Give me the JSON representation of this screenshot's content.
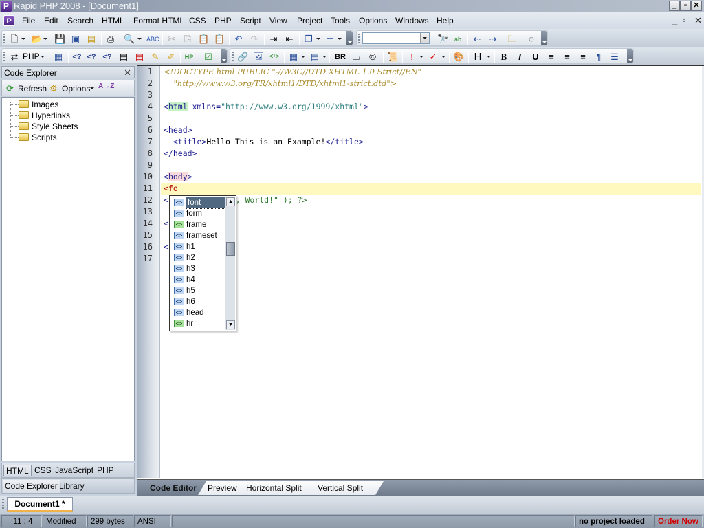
{
  "window": {
    "title": "Rapid PHP 2008 - [Document1]",
    "app_icon_letter": "P",
    "controls": {
      "minimize": "_",
      "restore": "▫",
      "close": "✕"
    }
  },
  "menubar": {
    "items": [
      {
        "label": "File",
        "mnemonic": "F"
      },
      {
        "label": "Edit",
        "mnemonic": "E"
      },
      {
        "label": "Search",
        "mnemonic": "S"
      },
      {
        "label": "HTML",
        "mnemonic": "L"
      },
      {
        "label": "Format HTML",
        "mnemonic": "m"
      },
      {
        "label": "CSS",
        "mnemonic": "C"
      },
      {
        "label": "PHP",
        "mnemonic": ""
      },
      {
        "label": "Script",
        "mnemonic": "i"
      },
      {
        "label": "View",
        "mnemonic": "V"
      },
      {
        "label": "Project",
        "mnemonic": "P"
      },
      {
        "label": "Tools",
        "mnemonic": "T"
      },
      {
        "label": "Options",
        "mnemonic": "O"
      },
      {
        "label": "Windows",
        "mnemonic": "W"
      },
      {
        "label": "Help",
        "mnemonic": "H"
      }
    ],
    "mdi_controls": {
      "minimize": "_",
      "restore": "▫",
      "close": "✕"
    }
  },
  "toolbar1": {
    "icons": [
      "new-document",
      "open-folder",
      "save",
      "save-all",
      "save-copy",
      "print",
      "preview",
      "spellcheck",
      "cut",
      "copy",
      "paste",
      "paste-special",
      "undo",
      "redo",
      "indent",
      "outdent",
      "window-layout",
      "panel-layout"
    ],
    "search_combo_value": "",
    "search_icons": [
      "find",
      "replace",
      "find-previous",
      "find-next",
      "find-in-files",
      "regex-search"
    ]
  },
  "toolbar2": {
    "php_button_label": "PHP",
    "php_snippets": [
      "<?",
      "<?↵",
      "<?="
    ],
    "br_label": "BR",
    "heading_label": "H",
    "format_labels": {
      "bold": "B",
      "italic": "I",
      "underline": "U",
      "paragraph": "¶"
    }
  },
  "code_explorer": {
    "title": "Code Explorer",
    "toolbar": {
      "refresh": "Refresh",
      "options": "Options",
      "sort": "A→Z"
    },
    "tree": [
      "Images",
      "Hyperlinks",
      "Style Sheets",
      "Scripts"
    ],
    "lang_tabs": [
      "HTML",
      "CSS",
      "JavaScript",
      "PHP"
    ],
    "active_lang_tab": "HTML",
    "panel_tabs": [
      "Code Explorer",
      "Library"
    ],
    "active_panel_tab": "Code Explorer"
  },
  "editor": {
    "line_numbers": [
      "1",
      "2",
      "3",
      "4",
      "5",
      "6",
      "7",
      "8",
      "9",
      "10",
      "11",
      "12",
      "13",
      "14",
      "15",
      "16",
      "17"
    ],
    "lines": {
      "l1": "<!DOCTYPE html PUBLIC \"-//W3C//DTD XHTML 1.0 Strict//EN\"",
      "l2": "    \"http://www.w3.org/TR/xhtml1/DTD/xhtml1-strict.dtd\">",
      "l4_open": "<",
      "l4_tag": "html",
      "l4_attr": " xmlns=",
      "l4_str": "\"http://www.w3.org/1999/xhtml\"",
      "l4_close": ">",
      "l6": "<head>",
      "l7_open": "  <title>",
      "l7_text": "Hello This is an Example!",
      "l7_close": "</title>",
      "l8": "</head>",
      "l10_open": "<",
      "l10_tag": "body",
      "l10_close": ">",
      "l11": "<fo",
      "l12_start": "<",
      "l12_rest": "ello, World!\" ); ?>",
      "l14": "<",
      "l16": "<"
    },
    "current_line": 11
  },
  "autocomplete": {
    "items": [
      {
        "name": "font",
        "icon": "blue"
      },
      {
        "name": "form",
        "icon": "blue"
      },
      {
        "name": "frame",
        "icon": "green"
      },
      {
        "name": "frameset",
        "icon": "blue"
      },
      {
        "name": "h1",
        "icon": "blue"
      },
      {
        "name": "h2",
        "icon": "blue"
      },
      {
        "name": "h3",
        "icon": "blue"
      },
      {
        "name": "h4",
        "icon": "blue"
      },
      {
        "name": "h5",
        "icon": "blue"
      },
      {
        "name": "h6",
        "icon": "blue"
      },
      {
        "name": "head",
        "icon": "blue"
      },
      {
        "name": "hr",
        "icon": "green"
      }
    ],
    "selected": "font",
    "icon_glyph": "<>"
  },
  "view_tabs": [
    "Code Editor",
    "Preview",
    "Horizontal Split",
    "Vertical Split"
  ],
  "active_view_tab": "Code Editor",
  "document_tab": "Document1 *",
  "statusbar": {
    "position": "11 : 4",
    "state": "Modified",
    "size": "299 bytes",
    "encoding": "ANSI",
    "project": "no project loaded",
    "order": "Order Now"
  },
  "colors": {
    "order_link": "#d10000",
    "current_line": "#fff9c0",
    "doc_tab_accent": "#f0b34a"
  }
}
